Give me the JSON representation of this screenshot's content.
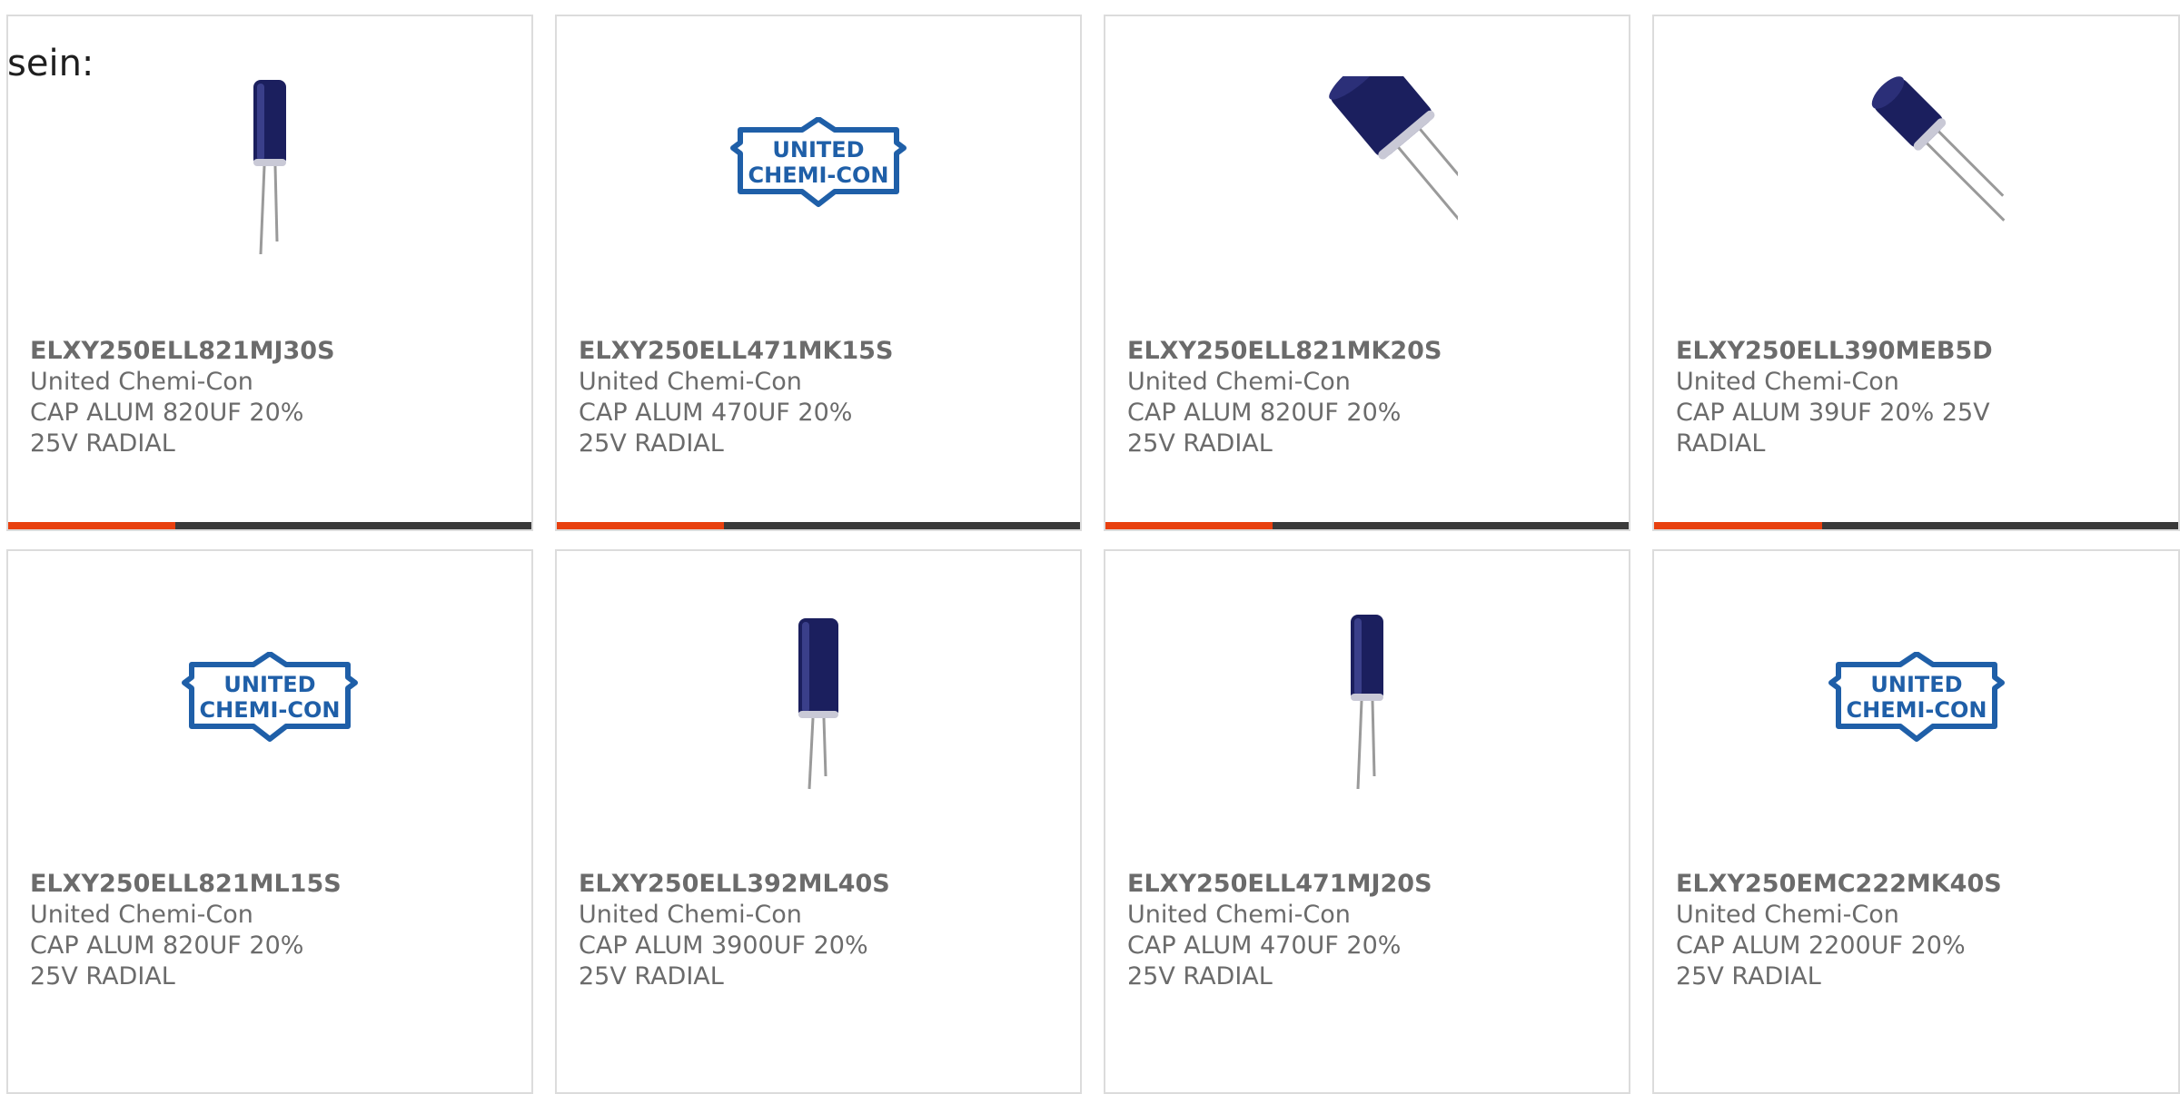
{
  "intro_text": "sein:",
  "colors": {
    "accent": "#e8400f",
    "bar_dark": "#3a3a3a",
    "border": "#dcdcdc",
    "text": "#6b6b6b",
    "logo_blue": "#1f5fa8",
    "capacitor_blue": "#1b1f5e"
  },
  "logo_text": {
    "line1": "UNITED",
    "line2": "CHEMI-CON"
  },
  "products": [
    {
      "part_number": "ELXY250ELL821MJ30S",
      "manufacturer": "United Chemi-Con",
      "description": "CAP ALUM 820UF 20% 25V RADIAL",
      "image": "capacitor-upright-small",
      "progress": 0.32
    },
    {
      "part_number": "ELXY250ELL471MK15S",
      "manufacturer": "United Chemi-Con",
      "description": "CAP ALUM 470UF 20% 25V RADIAL",
      "image": "united-chemi-con-logo",
      "progress": 0.32
    },
    {
      "part_number": "ELXY250ELL821MK20S",
      "manufacturer": "United Chemi-Con",
      "description": "CAP ALUM 820UF 20% 25V RADIAL",
      "image": "capacitor-tilted-large",
      "progress": 0.32
    },
    {
      "part_number": "ELXY250ELL390MEB5D",
      "manufacturer": "United Chemi-Con",
      "description": "CAP ALUM 39UF 20% 25V RADIAL",
      "image": "capacitor-tilted-small",
      "progress": 0.32
    },
    {
      "part_number": "ELXY250ELL821ML15S",
      "manufacturer": "United Chemi-Con",
      "description": "CAP ALUM 820UF 20% 25V RADIAL",
      "image": "united-chemi-con-logo"
    },
    {
      "part_number": "ELXY250ELL392ML40S",
      "manufacturer": "United Chemi-Con",
      "description": "CAP ALUM 3900UF 20% 25V RADIAL",
      "image": "capacitor-upright-large"
    },
    {
      "part_number": "ELXY250ELL471MJ20S",
      "manufacturer": "United Chemi-Con",
      "description": "CAP ALUM 470UF 20% 25V RADIAL",
      "image": "capacitor-upright-small"
    },
    {
      "part_number": "ELXY250EMC222MK40S",
      "manufacturer": "United Chemi-Con",
      "description": "CAP ALUM 2200UF 20% 25V RADIAL",
      "image": "united-chemi-con-logo"
    }
  ]
}
